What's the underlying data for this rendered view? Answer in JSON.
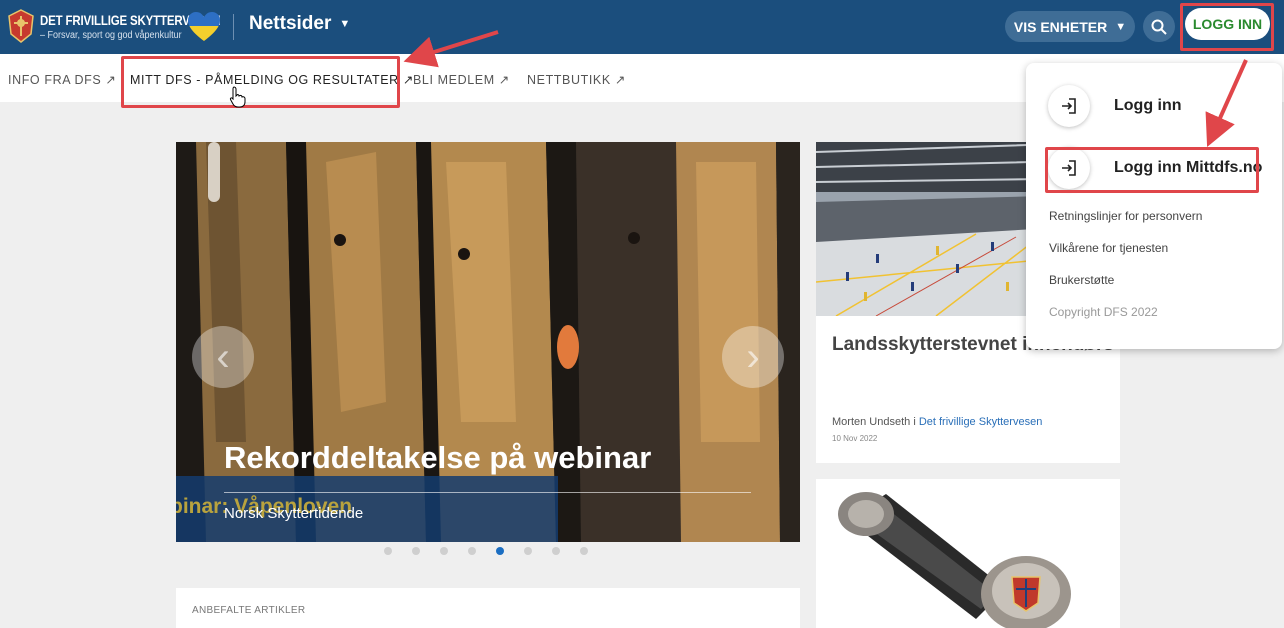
{
  "header": {
    "logo_title": "DET FRIVILLIGE SKYTTERVESEN",
    "logo_tagline": "– Forsvar, sport og god våpenkultur",
    "site_menu": "Nettsider",
    "vis_enheter": "VIS ENHETER",
    "logg_inn": "LOGG INN"
  },
  "subnav": {
    "items": [
      {
        "label": "INFO FRA DFS ↗"
      },
      {
        "label": "MITT DFS - PÅMELDING OG RESULTATER ↗"
      },
      {
        "label": "BLI MEDLEM ↗"
      },
      {
        "label": "NETTBUTIKK ↗"
      }
    ]
  },
  "hero": {
    "title": "Rekorddeltakelse på webinar",
    "subtitle": "Norsk Skyttertidende",
    "ghost_text": "binar: Våpenloven",
    "slide_count": 8,
    "active_slide_index": 4
  },
  "card1": {
    "title": "Landsskytterstevnet innendørs",
    "author": "Morten Undseth i ",
    "author_link": "Det frivillige Skyttervesen",
    "date": "10 Nov 2022"
  },
  "recommended": {
    "label": "ANBEFALTE ARTIKLER"
  },
  "dropdown": {
    "login": "Logg inn",
    "login_mittdfs": "Logg inn Mittdfs.no",
    "links": [
      "Retningslinjer for personvern",
      "Vilkårene for tjenesten",
      "Brukerstøtte"
    ],
    "copyright": "Copyright DFS 2022"
  },
  "colors": {
    "header_bg": "#1b4e7d",
    "login_text": "#2a8a2e",
    "highlight": "#e0464a",
    "link": "#2a6fb8"
  }
}
